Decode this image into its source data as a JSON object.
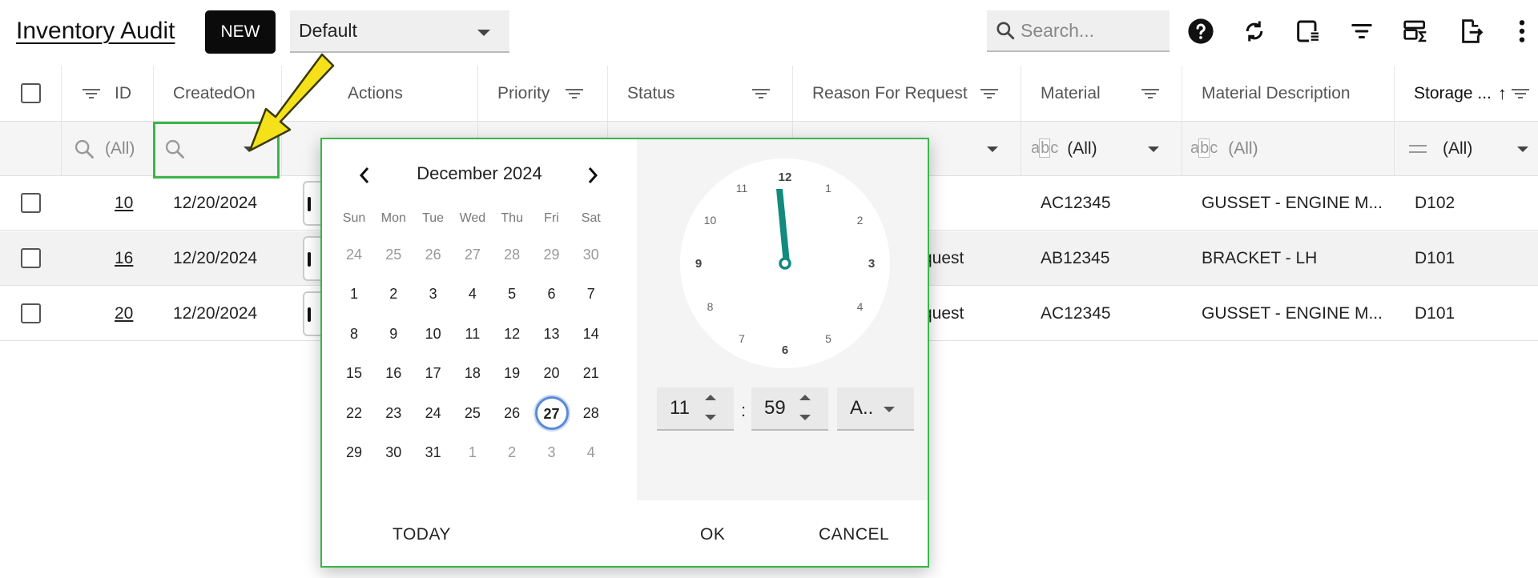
{
  "app": {
    "title": "Inventory Audit",
    "new_label": "NEW",
    "view_selected": "Default"
  },
  "search": {
    "placeholder": "Search..."
  },
  "toolbar_icons": [
    "help-icon",
    "refresh-icon",
    "column-chooser-icon",
    "filter-icon",
    "summary-icon",
    "export-icon",
    "more-vert-icon"
  ],
  "columns": {
    "id": "ID",
    "created_on": "CreatedOn",
    "actions": "Actions",
    "priority": "Priority",
    "status": "Status",
    "reason": "Reason For Request",
    "material": "Material",
    "material_description": "Material Description",
    "storage": "Storage ...",
    "sort_arrow": "↑"
  },
  "filters": {
    "id": "(All)",
    "material": "(All)",
    "material_description": "(All)",
    "storage": "(All)"
  },
  "rows": [
    {
      "id": "10",
      "created_on": "12/20/2024",
      "reason": "",
      "material": "AC12345",
      "material_description": "GUSSET - ENGINE M...",
      "storage": "D102"
    },
    {
      "id": "16",
      "created_on": "12/20/2024",
      "reason": "quest",
      "material": "AB12345",
      "material_description": "BRACKET - LH",
      "storage": "D101"
    },
    {
      "id": "20",
      "created_on": "12/20/2024",
      "reason": "quest",
      "material": "AC12345",
      "material_description": "GUSSET - ENGINE M...",
      "storage": "D101"
    }
  ],
  "picker": {
    "month_label": "December 2024",
    "weekdays": [
      "Sun",
      "Mon",
      "Tue",
      "Wed",
      "Thu",
      "Fri",
      "Sat"
    ],
    "weeks": [
      [
        "24",
        "25",
        "26",
        "27",
        "28",
        "29",
        "30"
      ],
      [
        "1",
        "2",
        "3",
        "4",
        "5",
        "6",
        "7"
      ],
      [
        "8",
        "9",
        "10",
        "11",
        "12",
        "13",
        "14"
      ],
      [
        "15",
        "16",
        "17",
        "18",
        "19",
        "20",
        "21"
      ],
      [
        "22",
        "23",
        "24",
        "25",
        "26",
        "27",
        "28"
      ],
      [
        "29",
        "30",
        "31",
        "1",
        "2",
        "3",
        "4"
      ]
    ],
    "selected_day": "27",
    "clock_numbers": [
      "12",
      "1",
      "2",
      "3",
      "4",
      "5",
      "6",
      "7",
      "8",
      "9",
      "10",
      "11"
    ],
    "hour": "11",
    "minute": "59",
    "meridiem": "A..",
    "time_separator": ":",
    "today_label": "TODAY",
    "ok_label": "OK",
    "cancel_label": "CANCEL",
    "accent_color": "#138a7e",
    "border_color": "#3cb54a"
  }
}
